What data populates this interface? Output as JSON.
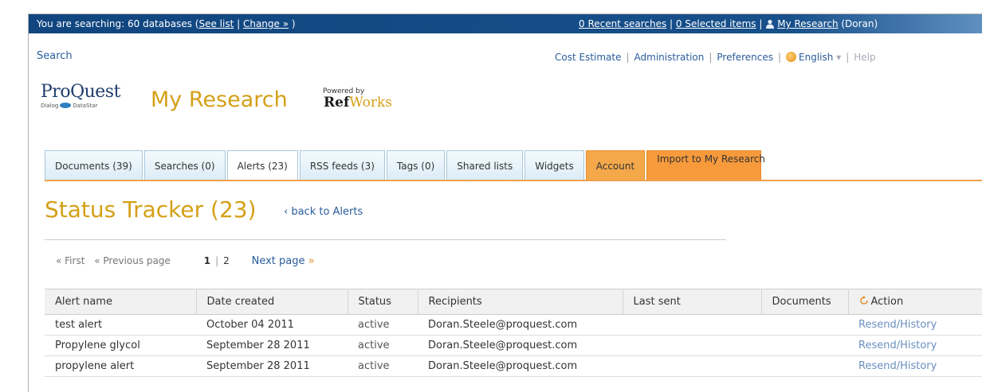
{
  "topbar": {
    "searching_prefix": "You are searching: 60 databases (",
    "see_list": "See list",
    "sep": " | ",
    "change": "Change »",
    "searching_suffix": " )",
    "recent_searches": "0 Recent searches",
    "selected_items": "0 Selected items",
    "my_research": "My Research",
    "user": " (Doran)",
    "icon": "user-icon"
  },
  "utility": {
    "search": "Search",
    "cost_estimate": "Cost Estimate",
    "administration": "Administration",
    "preferences": "Preferences",
    "language": "English",
    "help": "Help"
  },
  "branding": {
    "logo_text": "ProQuest",
    "logo_sub_left": "Dialog",
    "logo_sub_right": "DataStar",
    "title": "My Research",
    "powered_by": "Powered by",
    "refworks_ref": "Ref",
    "refworks_works": "Works"
  },
  "tabs": [
    {
      "label": "Documents (39)"
    },
    {
      "label": "Searches (0)"
    },
    {
      "label": "Alerts (23)"
    },
    {
      "label": "RSS feeds (3)"
    },
    {
      "label": "Tags (0)"
    },
    {
      "label": "Shared lists"
    },
    {
      "label": "Widgets"
    },
    {
      "label": "Account"
    },
    {
      "label": "Import to My Research"
    }
  ],
  "page": {
    "heading": "Status Tracker (23)",
    "back_link": "‹ back to Alerts"
  },
  "pager": {
    "first": "« First",
    "previous": "« Previous page",
    "page1": "1",
    "page2": "2",
    "next": "Next page",
    "next_arrow": "»"
  },
  "table": {
    "headers": [
      "Alert name",
      "Date created",
      "Status",
      "Recipients",
      "Last sent",
      "Documents",
      "Action"
    ],
    "rows": [
      {
        "name": "test alert",
        "date": "October 04 2011",
        "status": "active",
        "recipients": "Doran.Steele@proquest.com",
        "last_sent": "",
        "documents": "",
        "action": "Resend/History"
      },
      {
        "name": "Propylene glycol",
        "date": "September 28 2011",
        "status": "active",
        "recipients": "Doran.Steele@proquest.com",
        "last_sent": "",
        "documents": "",
        "action": "Resend/History"
      },
      {
        "name": "propylene alert",
        "date": "September 28 2011",
        "status": "active",
        "recipients": "Doran.Steele@proquest.com",
        "last_sent": "",
        "documents": "",
        "action": "Resend/History"
      }
    ]
  },
  "colors": {
    "topbar": "#17508b",
    "accent_gold": "#d4a017",
    "link_blue": "#2a5d9c",
    "orange_tab": "#f5a84a"
  }
}
